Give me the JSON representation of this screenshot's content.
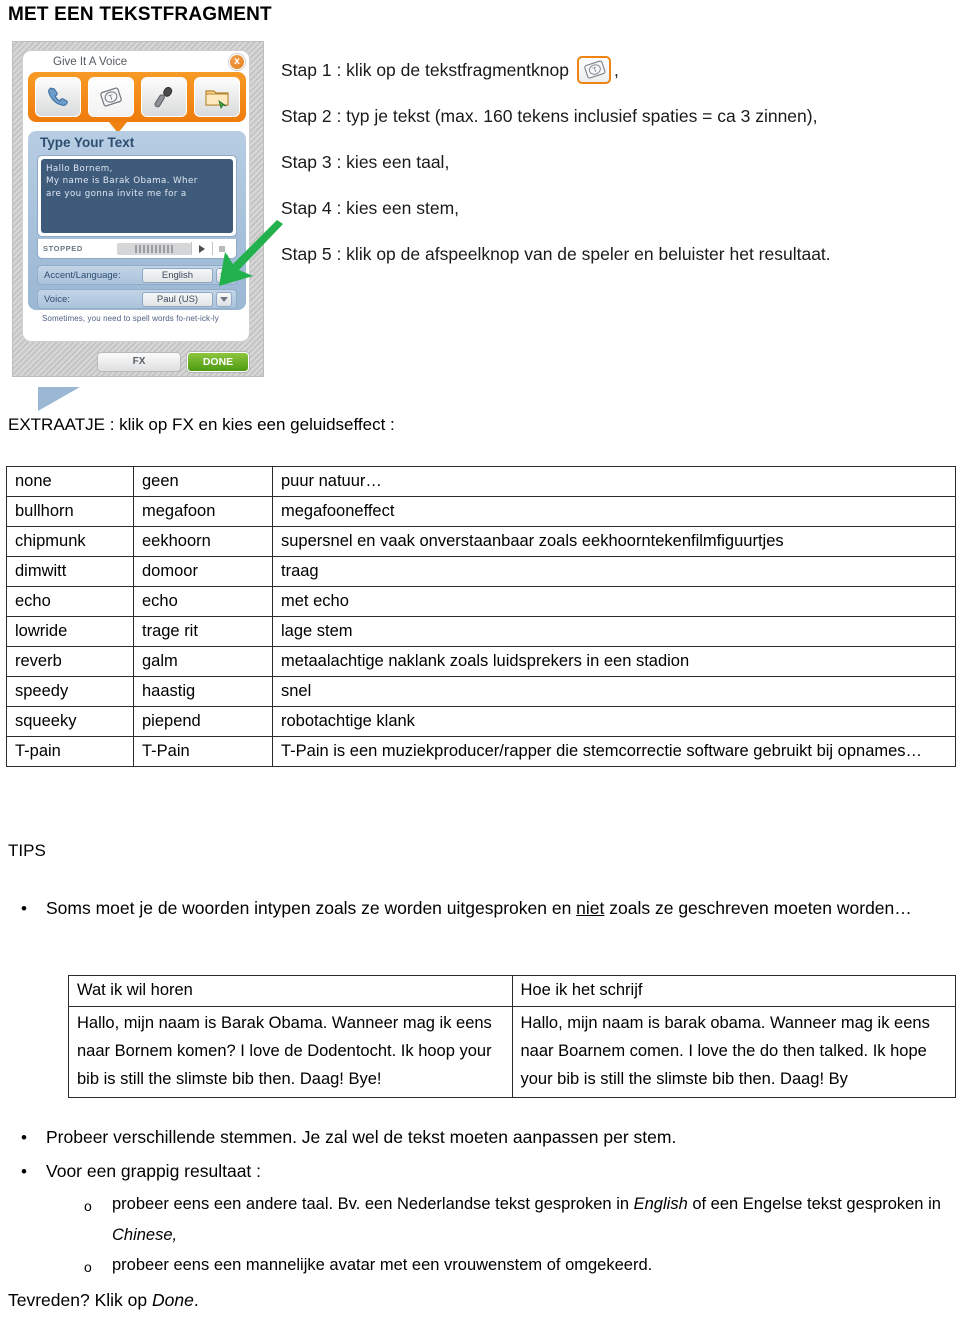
{
  "document": {
    "title": "MET EEN TEKSTFRAGMENT"
  },
  "widget": {
    "name": "give-it-a-voice",
    "title": "Give It A Voice",
    "close_label": "x",
    "toolbar_icons": [
      "phone-icon",
      "text-card-icon",
      "microphone-icon",
      "folder-icon"
    ],
    "panel_label": "Type Your Text",
    "text_value": "Hallo Bornem,\nMy name is Barak Obama. Wher\nare you gonna invite me for a",
    "player": {
      "status": "STOPPED",
      "play_icon": "play-icon",
      "stop_icon": "stop-icon"
    },
    "accent_label": "Accent/Language:",
    "accent_value": "English",
    "voice_label": "Voice:",
    "voice_value": "Paul (US)",
    "hint": "Sometimes, you need to spell words fo-net-ick-ly",
    "fx_button": "FX",
    "done_button": "DONE",
    "arrow_color": "#22b14c"
  },
  "steps": [
    {
      "pre": "Stap 1 : klik op de tekstfragmentknop",
      "icon": "text-card-icon",
      "post": ","
    },
    {
      "text": "Stap 2 : typ je tekst (max. 160 tekens inclusief spaties = ca 3 zinnen),"
    },
    {
      "text": "Stap 3 : kies een taal,"
    },
    {
      "text": "Stap 4 : kies een stem,"
    },
    {
      "text": "Stap 5 : klik op de afspeelknop van de speler en beluister het resultaat."
    }
  ],
  "extra": {
    "intro": "EXTRAATJE : klik op FX en kies een geluidseffect :",
    "rows": [
      {
        "en": "none",
        "nl": "geen",
        "desc": "puur natuur…"
      },
      {
        "en": "bullhorn",
        "nl": "megafoon",
        "desc": "megafooneffect"
      },
      {
        "en": "chipmunk",
        "nl": "eekhoorn",
        "desc": "supersnel en vaak onverstaanbaar zoals eekhoorntekenfilmfiguurtjes"
      },
      {
        "en": "dimwitt",
        "nl": "domoor",
        "desc": "traag"
      },
      {
        "en": "echo",
        "nl": "echo",
        "desc": "met echo"
      },
      {
        "en": "lowride",
        "nl": "trage rit",
        "desc": "lage stem"
      },
      {
        "en": "reverb",
        "nl": "galm",
        "desc": "metaalachtige naklank zoals luidsprekers in een stadion"
      },
      {
        "en": "speedy",
        "nl": "haastig",
        "desc": "snel"
      },
      {
        "en": "squeeky",
        "nl": "piepend",
        "desc": "robotachtige klank"
      },
      {
        "en": "T-pain",
        "nl": "T-Pain",
        "desc": "T-Pain is een muziekproducer/rapper die stemcorrectie software gebruikt bij opnames…"
      }
    ]
  },
  "tips": {
    "heading": "TIPS",
    "tip1_part1": "Soms moet je de woorden intypen zoals ze worden uitgesproken en ",
    "tip1_underlined": "niet",
    "tip1_part2": " zoals ze geschreven moeten worden…",
    "comparison": {
      "header_left": "Wat ik wil horen",
      "header_right": "Hoe ik het schrijf",
      "left": "Hallo, mijn naam is Barak Obama. Wanneer mag ik eens naar Bornem komen? I love de Dodentocht. Ik hoop your bib is still the slimste bib then. Daag! Bye!",
      "right": "Hallo, mijn naam is barak obama. Wanneer mag ik eens naar Boarnem comen. I love the do then talked. Ik hope your bib is still the slimste bib then. Daag! By"
    },
    "tip2": "Probeer verschillende stemmen. Je zal wel de tekst moeten aanpassen per stem.",
    "tip3": "Voor een grappig resultaat :",
    "sub1_part1": "probeer eens een andere taal. Bv. een Nederlandse tekst gesproken in ",
    "sub1_italic1": "English",
    "sub1_part2": " of een Engelse tekst gesproken in ",
    "sub1_italic2": "Chinese,",
    "sub2": "probeer eens een mannelijke avatar met een vrouwenstem of omgekeerd.",
    "bullet_glyph": "•",
    "subbullet_glyph": "o"
  },
  "closing": {
    "part1": "Tevreden? Klik op ",
    "italic": "Done",
    "part2": "."
  }
}
